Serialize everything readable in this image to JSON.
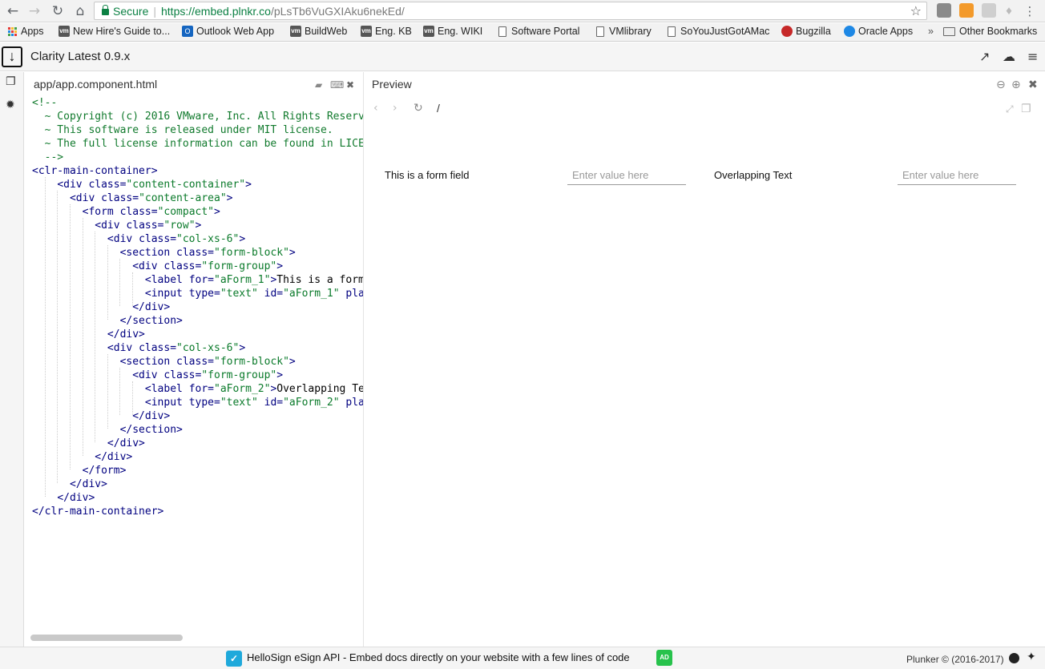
{
  "browser": {
    "secure_label": "Secure",
    "url_host": "https://embed.plnkr.co",
    "url_path": "/pLsTb6VuGXIAku6nekEd/"
  },
  "bookmarks": [
    {
      "label": "Apps",
      "icon": "apps-grid-icon"
    },
    {
      "label": "New Hire's Guide to...",
      "icon": "vm-icon"
    },
    {
      "label": "Outlook Web App",
      "icon": "outlook-icon"
    },
    {
      "label": "BuildWeb",
      "icon": "vm-icon"
    },
    {
      "label": "Eng. KB",
      "icon": "vm-icon"
    },
    {
      "label": "Eng. WIKI",
      "icon": "vm-icon"
    },
    {
      "label": "Software Portal",
      "icon": "page-icon"
    },
    {
      "label": "VMlibrary",
      "icon": "page-icon"
    },
    {
      "label": "SoYouJustGotAMac",
      "icon": "page-icon"
    },
    {
      "label": "Bugzilla",
      "icon": "bugzilla-icon"
    },
    {
      "label": "Oracle Apps",
      "icon": "oracle-icon"
    }
  ],
  "bookmarks_overflow": "»",
  "other_bookmarks": "Other Bookmarks",
  "plunker": {
    "title": "Clarity Latest 0.9.x"
  },
  "editor": {
    "filename": "app/app.component.html"
  },
  "preview": {
    "title": "Preview",
    "path": "/",
    "form": {
      "label1": "This is a form field",
      "placeholder1": "Enter value here",
      "label2": "Overlapping Text",
      "placeholder2": "Enter value here"
    }
  },
  "footer": {
    "ad_text": "HelloSign eSign API - Embed docs directly on your website with a few lines of code",
    "ad_tag": "AD",
    "copyright": "Plunker © (2016-2017)"
  },
  "colors": {
    "secure_green": "#0b8043",
    "ad_blue": "#1fa9db",
    "ad_green": "#27c24c"
  }
}
